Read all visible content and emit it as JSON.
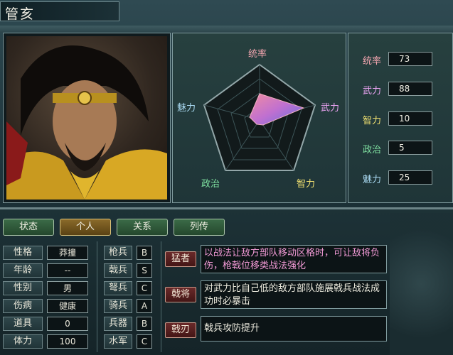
{
  "name": "管亥",
  "radar": {
    "labels": {
      "lead": "统率",
      "war": "武力",
      "int": "智力",
      "pol": "政治",
      "chr": "魅力"
    },
    "colors": {
      "lead": "#f4a6b0",
      "war": "#e8a2f0",
      "int": "#f0e070",
      "pol": "#7fe0a0",
      "chr": "#a8d8f0"
    }
  },
  "stats": [
    {
      "label": "统率",
      "value": "73",
      "color": "#f4a6b0"
    },
    {
      "label": "武力",
      "value": "88",
      "color": "#e8a2f0"
    },
    {
      "label": "智力",
      "value": "10",
      "color": "#f0e070"
    },
    {
      "label": "政治",
      "value": "5",
      "color": "#7fe0a0"
    },
    {
      "label": "魅力",
      "value": "25",
      "color": "#a8d8f0"
    }
  ],
  "tabs": [
    "状态",
    "个人",
    "关系",
    "列传"
  ],
  "active_tab": "个人",
  "profile": [
    {
      "label": "性格",
      "value": "莽撞"
    },
    {
      "label": "年龄",
      "value": "--"
    },
    {
      "label": "性别",
      "value": "男"
    },
    {
      "label": "伤病",
      "value": "健康"
    },
    {
      "label": "道具",
      "value": "0"
    },
    {
      "label": "体力",
      "value": "100"
    }
  ],
  "aptitudes": [
    {
      "label": "枪兵",
      "value": "B"
    },
    {
      "label": "戟兵",
      "value": "S"
    },
    {
      "label": "弩兵",
      "value": "C"
    },
    {
      "label": "骑兵",
      "value": "A"
    },
    {
      "label": "兵器",
      "value": "B"
    },
    {
      "label": "水军",
      "value": "C"
    }
  ],
  "skills": [
    {
      "name": "猛者",
      "desc": "以战法让敌方部队移动区格时，可让敌将负伤，枪戟位移类战法强化",
      "style": "pink"
    },
    {
      "name": "戟将",
      "desc": "对武力比自己低的敌方部队施展戟兵战法成功时必暴击",
      "style": "white"
    },
    {
      "name": "戟刃",
      "desc": "戟兵攻防提升",
      "style": "white"
    }
  ]
}
